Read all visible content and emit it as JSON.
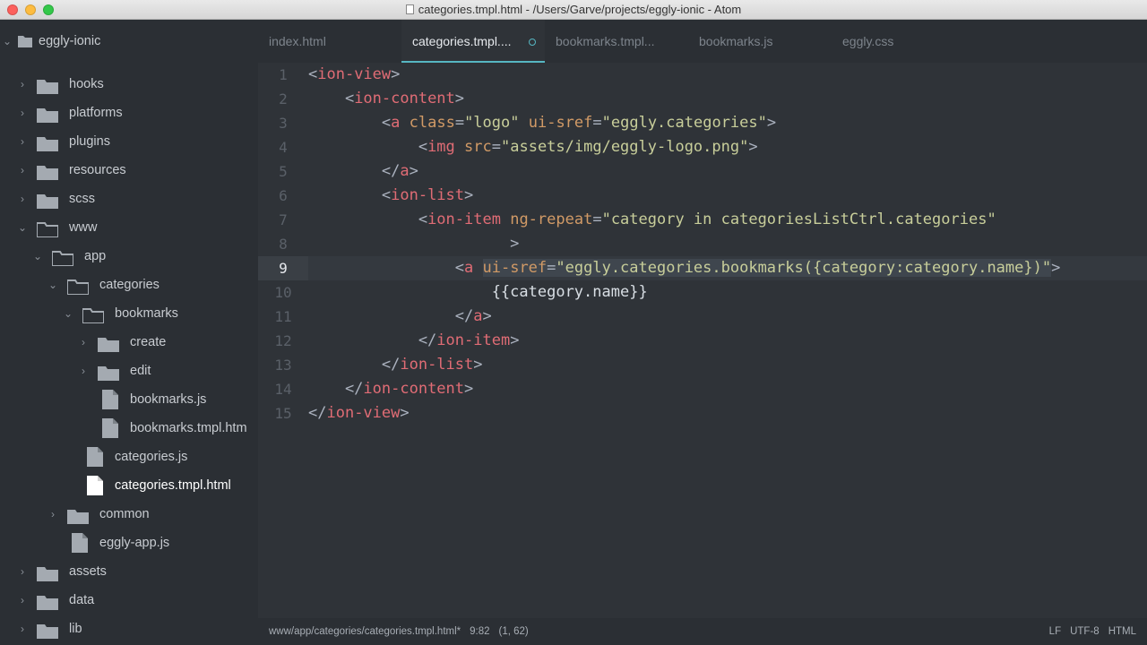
{
  "window": {
    "title": "categories.tmpl.html - /Users/Garve/projects/eggly-ionic - Atom"
  },
  "sidebar": {
    "project": "eggly-ionic",
    "items": [
      {
        "label": "hooks"
      },
      {
        "label": "platforms"
      },
      {
        "label": "plugins"
      },
      {
        "label": "resources"
      },
      {
        "label": "scss"
      },
      {
        "label": "www"
      },
      {
        "label": "app"
      },
      {
        "label": "categories"
      },
      {
        "label": "bookmarks"
      },
      {
        "label": "create"
      },
      {
        "label": "edit"
      },
      {
        "label": "bookmarks.js"
      },
      {
        "label": "bookmarks.tmpl.htm"
      },
      {
        "label": "categories.js"
      },
      {
        "label": "categories.tmpl.html"
      },
      {
        "label": "common"
      },
      {
        "label": "eggly-app.js"
      },
      {
        "label": "assets"
      },
      {
        "label": "data"
      },
      {
        "label": "lib"
      }
    ]
  },
  "tabs": [
    {
      "label": "index.html"
    },
    {
      "label": "categories.tmpl...."
    },
    {
      "label": "bookmarks.tmpl..."
    },
    {
      "label": "bookmarks.js"
    },
    {
      "label": "eggly.css"
    }
  ],
  "editor": {
    "current_line": "9",
    "lines": [
      {
        "n": "1",
        "tokens": [
          [
            "p",
            "<"
          ],
          [
            "t",
            "ion-view"
          ],
          [
            "p",
            ">"
          ]
        ]
      },
      {
        "n": "2",
        "tokens": [
          [
            "p",
            "    <"
          ],
          [
            "t",
            "ion-content"
          ],
          [
            "p",
            ">"
          ]
        ]
      },
      {
        "n": "3",
        "tokens": [
          [
            "p",
            "        <"
          ],
          [
            "t",
            "a"
          ],
          [
            "p",
            " "
          ],
          [
            "a",
            "class"
          ],
          [
            "p",
            "="
          ],
          [
            "s",
            "\"logo\""
          ],
          [
            "p",
            " "
          ],
          [
            "a",
            "ui-sref"
          ],
          [
            "p",
            "="
          ],
          [
            "s",
            "\"eggly.categories\""
          ],
          [
            "p",
            ">"
          ]
        ]
      },
      {
        "n": "4",
        "tokens": [
          [
            "p",
            "            <"
          ],
          [
            "t",
            "img"
          ],
          [
            "p",
            " "
          ],
          [
            "a",
            "src"
          ],
          [
            "p",
            "="
          ],
          [
            "s",
            "\"assets/img/eggly-logo.png\""
          ],
          [
            "p",
            ">"
          ]
        ]
      },
      {
        "n": "5",
        "tokens": [
          [
            "p",
            "        </"
          ],
          [
            "t",
            "a"
          ],
          [
            "p",
            ">"
          ]
        ]
      },
      {
        "n": "6",
        "tokens": [
          [
            "p",
            "        <"
          ],
          [
            "t",
            "ion-list"
          ],
          [
            "p",
            ">"
          ]
        ]
      },
      {
        "n": "7",
        "tokens": [
          [
            "p",
            "            <"
          ],
          [
            "t",
            "ion-item"
          ],
          [
            "p",
            " "
          ],
          [
            "a",
            "ng-repeat"
          ],
          [
            "p",
            "="
          ],
          [
            "s",
            "\"category in categoriesListCtrl.categories\""
          ]
        ]
      },
      {
        "n": "8",
        "tokens": [
          [
            "p",
            "                      >"
          ]
        ]
      },
      {
        "n": "9",
        "tokens": [
          [
            "p",
            "                <"
          ],
          [
            "t",
            "a"
          ],
          [
            "p",
            " "
          ],
          [
            "a",
            "ui-sref"
          ],
          [
            "p",
            "="
          ],
          [
            "s",
            "\"eggly.categories.bookmarks({category:category.name})\""
          ],
          [
            "p",
            ">"
          ]
        ]
      },
      {
        "n": "10",
        "tokens": [
          [
            "at",
            "                    {{category.name}}"
          ]
        ]
      },
      {
        "n": "11",
        "tokens": [
          [
            "p",
            "                </"
          ],
          [
            "t",
            "a"
          ],
          [
            "p",
            ">"
          ]
        ]
      },
      {
        "n": "12",
        "tokens": [
          [
            "p",
            "            </"
          ],
          [
            "t",
            "ion-item"
          ],
          [
            "p",
            ">"
          ]
        ]
      },
      {
        "n": "13",
        "tokens": [
          [
            "p",
            "        </"
          ],
          [
            "t",
            "ion-list"
          ],
          [
            "p",
            ">"
          ]
        ]
      },
      {
        "n": "14",
        "tokens": [
          [
            "p",
            "    </"
          ],
          [
            "t",
            "ion-content"
          ],
          [
            "p",
            ">"
          ]
        ]
      },
      {
        "n": "15",
        "tokens": [
          [
            "p",
            "</"
          ],
          [
            "t",
            "ion-view"
          ],
          [
            "p",
            ">"
          ]
        ]
      }
    ]
  },
  "statusbar": {
    "path": "www/app/categories/categories.tmpl.html*",
    "cursor": "9:82",
    "selection": "(1, 62)",
    "line_ending": "LF",
    "encoding": "UTF-8",
    "grammar": "HTML"
  },
  "colors": {
    "tag": "#e06c75",
    "attribute": "#d19a66",
    "string": "#c8ce9a",
    "accent": "#56b6c2",
    "background": "#2f3338"
  }
}
